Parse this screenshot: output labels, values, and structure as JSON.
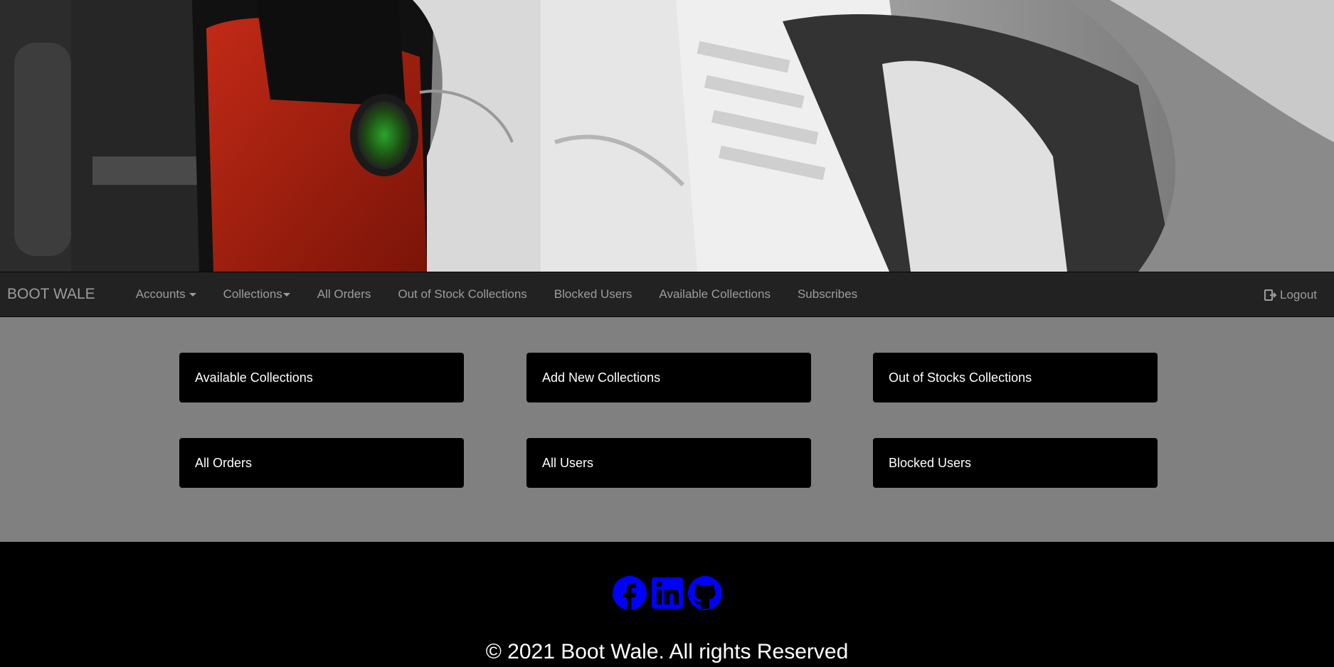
{
  "navbar": {
    "brand": "BOOT WALE",
    "items": [
      {
        "label": "Accounts",
        "dropdown": true
      },
      {
        "label": "Collections",
        "dropdown": true
      },
      {
        "label": "All Orders"
      },
      {
        "label": "Out of Stock Collections"
      },
      {
        "label": "Blocked Users"
      },
      {
        "label": "Available Collections"
      },
      {
        "label": "Subscribes"
      }
    ],
    "logout": "Logout"
  },
  "tiles": [
    {
      "label": "Available Collections"
    },
    {
      "label": "Add New Collections"
    },
    {
      "label": "Out of Stocks Collections"
    },
    {
      "label": "All Orders"
    },
    {
      "label": "All Users"
    },
    {
      "label": "Blocked Users"
    }
  ],
  "footer": {
    "social": [
      {
        "icon": "facebook-icon",
        "color": "#0000ff"
      },
      {
        "icon": "linkedin-icon",
        "color": "#0000ff"
      },
      {
        "icon": "github-icon",
        "color": "#0000ff"
      }
    ],
    "copyright": "© 2021 Boot Wale. All rights Reserved"
  }
}
